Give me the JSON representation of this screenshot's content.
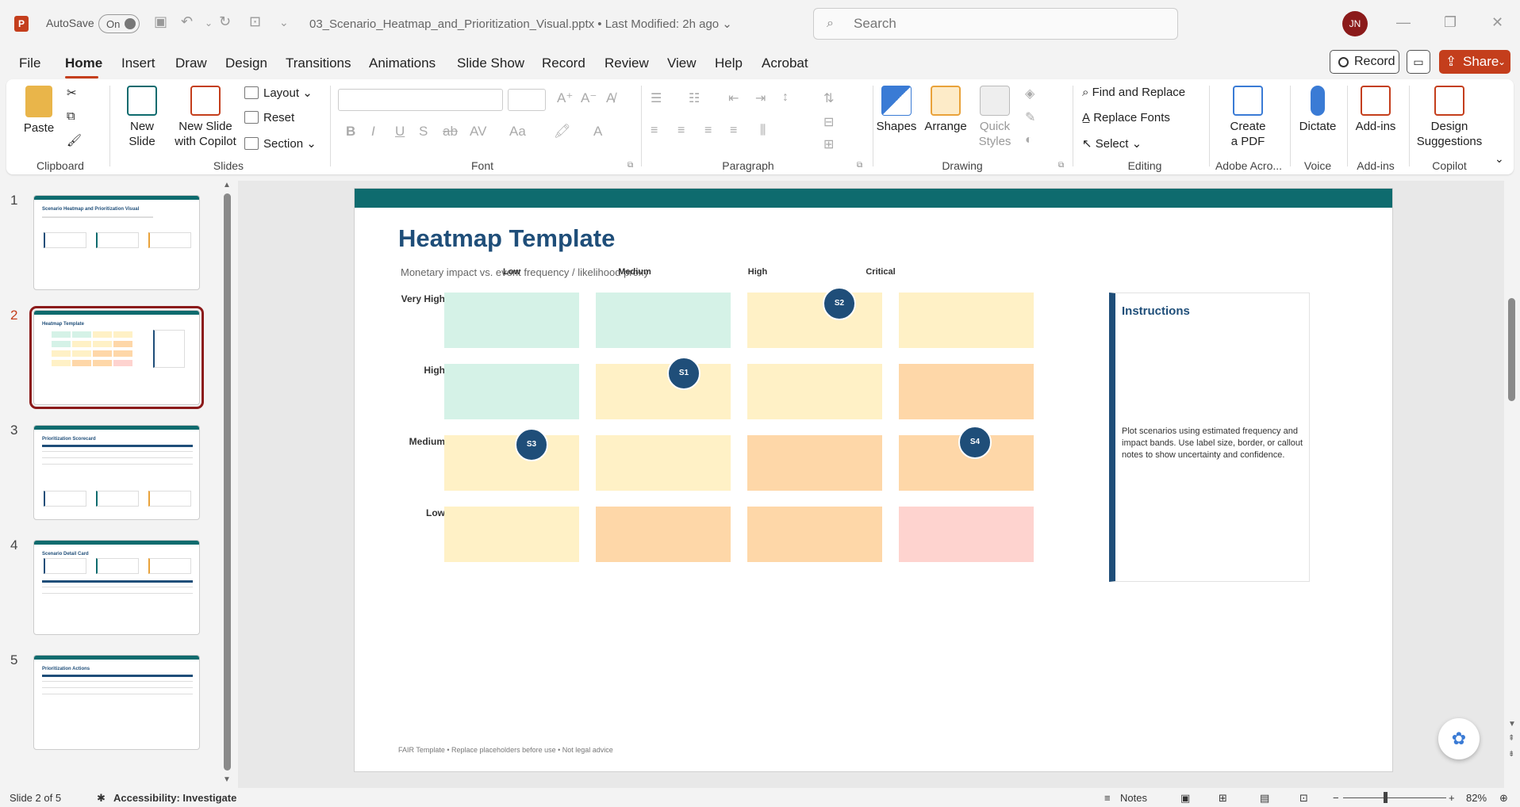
{
  "titlebar": {
    "autosave_label": "AutoSave",
    "autosave_state": "On",
    "doc_title": "03_Scenario_Heatmap_and_Prioritization_Visual.pptx  •  Last Modified: 2h ago  ⌄",
    "search_placeholder": "Search",
    "avatar_initials": "JN",
    "app_icon": "P"
  },
  "menu": {
    "items": [
      "File",
      "Home",
      "Insert",
      "Draw",
      "Design",
      "Transitions",
      "Animations",
      "Slide Show",
      "Record",
      "Review",
      "View",
      "Help",
      "Acrobat"
    ],
    "active": "Home",
    "record_label": "Record",
    "share_label": "Share"
  },
  "ribbon": {
    "clipboard": {
      "paste": "Paste",
      "group": "Clipboard"
    },
    "slides": {
      "new_slide": "New Slide",
      "new_slide_copilot_1": "New Slide",
      "new_slide_copilot_2": "with Copilot",
      "layout": "Layout",
      "reset": "Reset",
      "section": "Section",
      "group": "Slides"
    },
    "font": {
      "group": "Font"
    },
    "paragraph": {
      "group": "Paragraph"
    },
    "drawing": {
      "shapes": "Shapes",
      "arrange": "Arrange",
      "quick_styles_1": "Quick",
      "quick_styles_2": "Styles",
      "group": "Drawing"
    },
    "editing": {
      "find_replace": "Find and Replace",
      "replace_fonts": "Replace Fonts",
      "select": "Select",
      "group": "Editing"
    },
    "adobe": {
      "create_pdf_1": "Create",
      "create_pdf_2": "a PDF",
      "group": "Adobe Acro..."
    },
    "voice": {
      "dictate": "Dictate",
      "group": "Voice"
    },
    "addins": {
      "addins": "Add-ins",
      "group": "Add-ins"
    },
    "copilot": {
      "design_1": "Design",
      "design_2": "Suggestions",
      "group": "Copilot"
    }
  },
  "thumbnails": [
    {
      "num": "1",
      "title": "Scenario Heatmap and Prioritization Visual"
    },
    {
      "num": "2",
      "title": "Heatmap Template"
    },
    {
      "num": "3",
      "title": "Prioritization Scorecard"
    },
    {
      "num": "4",
      "title": "Scenario Detail Card"
    },
    {
      "num": "5",
      "title": "Prioritization Actions"
    }
  ],
  "slide": {
    "title": "Heatmap Template",
    "subtitle": "Monetary impact vs. event frequency / likelihood proxy",
    "columns": [
      "Low",
      "Medium",
      "High",
      "Critical"
    ],
    "rows": [
      "Very High",
      "High",
      "Medium",
      "Low"
    ],
    "cell_colors": [
      [
        "#d5f2e7",
        "#d5f2e7",
        "#fff1c6",
        "#fff1c6"
      ],
      [
        "#d5f2e7",
        "#fff1c6",
        "#fff1c6",
        "#fed7a8"
      ],
      [
        "#fff1c6",
        "#fff1c6",
        "#fed7a8",
        "#fed7a8"
      ],
      [
        "#fff1c6",
        "#fed7a8",
        "#fed7a8",
        "#fed3cf"
      ]
    ],
    "bubbles": [
      {
        "label": "S2",
        "row": "Very High",
        "col": "High"
      },
      {
        "label": "S1",
        "row": "High",
        "col": "Medium"
      },
      {
        "label": "S3",
        "row": "Medium",
        "col": "Low"
      },
      {
        "label": "S4",
        "row": "Medium",
        "col": "Critical"
      }
    ],
    "instructions_title": "Instructions",
    "instructions_body": "Plot scenarios using estimated frequency and impact bands. Use label size, border, or callout notes to show uncertainty and confidence.",
    "footer": "FAIR Template • Replace placeholders before use • Not legal advice"
  },
  "status": {
    "slide_count": "Slide 2 of 5",
    "accessibility": "Accessibility: Investigate",
    "notes": "Notes",
    "zoom": "82%"
  },
  "colors": {
    "accent": "#c43e1c",
    "teal": "#0e6b6e",
    "navy": "#1f4e79"
  }
}
